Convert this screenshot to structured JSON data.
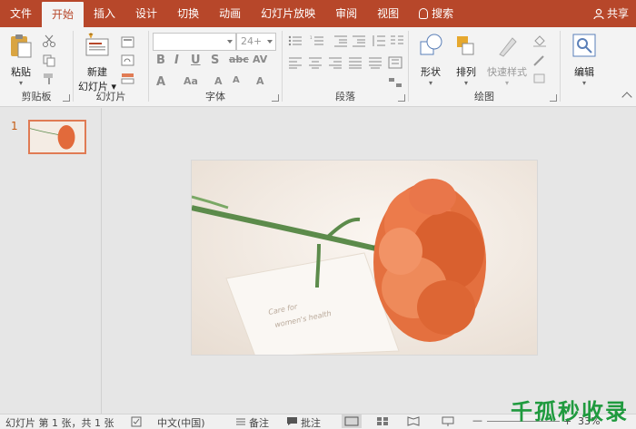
{
  "tabs": [
    "文件",
    "开始",
    "插入",
    "设计",
    "切换",
    "动画",
    "幻灯片放映",
    "审阅",
    "视图",
    "搜索"
  ],
  "active_tab": "开始",
  "share_label": "共享",
  "ribbon": {
    "clipboard": {
      "paste_label": "粘贴",
      "group_label": "剪贴板"
    },
    "slides": {
      "new_slide_label_1": "新建",
      "new_slide_label_2": "幻灯片",
      "group_label": "幻灯片"
    },
    "font": {
      "font_name": "",
      "font_size": "24+",
      "group_label": "字体"
    },
    "paragraph": {
      "group_label": "段落"
    },
    "drawing": {
      "shape_label": "形状",
      "arrange_label": "排列",
      "quick_style_label": "快速样式",
      "group_label": "绘图"
    },
    "editing": {
      "edit_label": "编辑"
    }
  },
  "thumbnail": {
    "slide_number": "1"
  },
  "slide_image": {
    "caption_line1": "Care for",
    "caption_line2": "women's health"
  },
  "status": {
    "slide_info": "幻灯片 第 1 张，共 1 张",
    "language": "中文(中国)",
    "notes_label": "备注",
    "comments_label": "批注",
    "zoom": "33%"
  },
  "watermark": "千孤秒收录",
  "colors": {
    "brand": "#b7472a",
    "accent": "#e07b54"
  }
}
